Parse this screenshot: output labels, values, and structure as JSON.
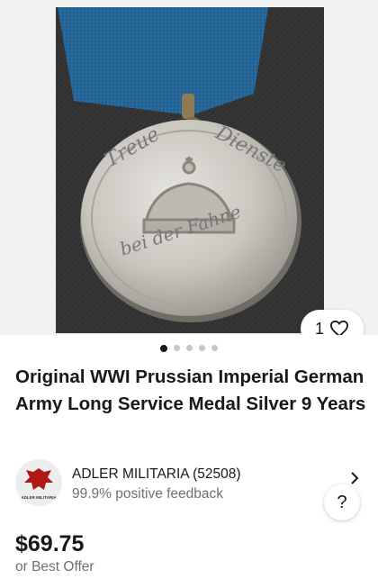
{
  "gallery": {
    "medal_inscription_top_left": "Treue",
    "medal_inscription_top_right": "Dienste",
    "medal_inscription_bottom": "bei der Fahne",
    "like_count": "1",
    "pages": 5,
    "current_page": 1
  },
  "listing": {
    "title": "Original WWI Prussian Imperial German Army Long Service Medal Silver 9 Years",
    "price": "$69.75",
    "offer_text": "or Best Offer"
  },
  "seller": {
    "avatar_text": "ADLER MILITARIA",
    "name": "ADLER MILITARIA (52508)",
    "feedback": "99.9% positive feedback"
  },
  "help": {
    "label": "?"
  },
  "icons": {
    "like": "heart-icon",
    "seller_link": "chevron-right-icon"
  }
}
